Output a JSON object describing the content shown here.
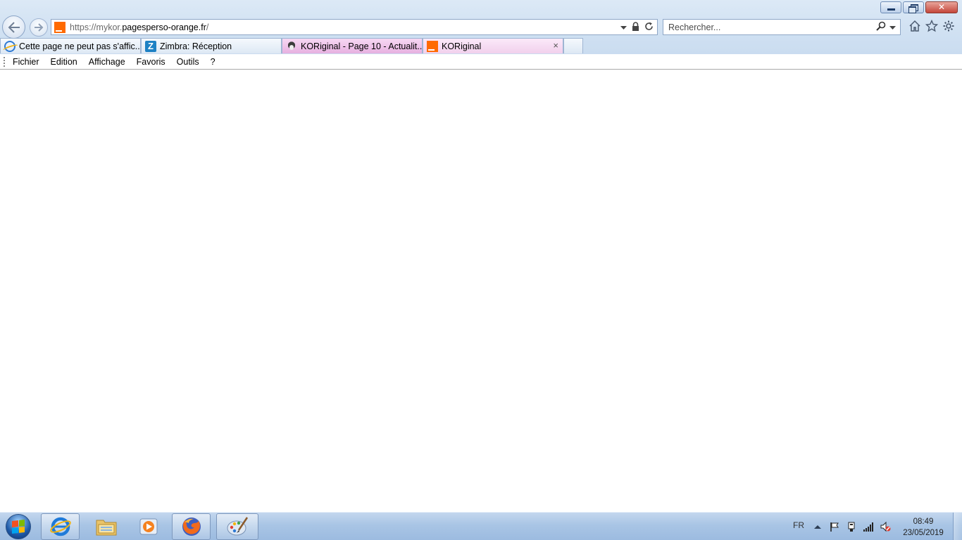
{
  "browser": {
    "address": {
      "scheme": "https://",
      "subdomain": "mykor.",
      "host": "pagesperso-orange.fr",
      "path": "/"
    },
    "search": {
      "placeholder": "Rechercher..."
    },
    "tabs": [
      {
        "label": "Cette page ne peut pas s'affic...",
        "icon": "ie-icon"
      },
      {
        "label": "Zimbra: Réception",
        "icon": "zimbra-icon",
        "icon_letter": "Z"
      },
      {
        "label": "KORiginal - Page 10 - Actualit...",
        "icon": "penguin-icon"
      },
      {
        "label": "KORiginal",
        "icon": "orange-icon",
        "close": "×"
      }
    ],
    "menu": [
      "Fichier",
      "Edition",
      "Affichage",
      "Favoris",
      "Outils",
      "?"
    ]
  },
  "taskbar": {
    "apps": [
      "internet-explorer-icon",
      "file-explorer-icon",
      "media-player-icon",
      "firefox-icon",
      "paint-icon"
    ],
    "language": "FR",
    "time": "08:49",
    "date": "23/05/2019"
  },
  "colors": {
    "chrome_bg": "#cfe0f2",
    "active_tab": "#f1d0ec",
    "taskbar": "#a9c5e5",
    "orange_brand": "#ff6a00"
  }
}
